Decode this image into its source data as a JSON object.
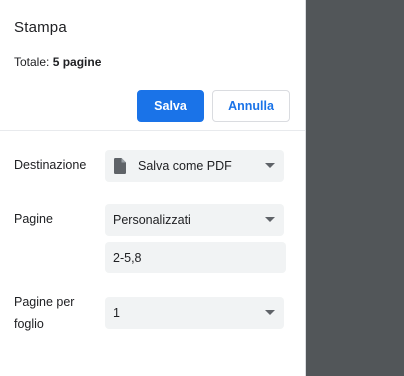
{
  "dialog": {
    "title": "Stampa",
    "summary_label": "Totale:",
    "summary_value": "5 pagine"
  },
  "actions": {
    "save_label": "Salva",
    "cancel_label": "Annulla"
  },
  "settings": {
    "destination": {
      "label": "Destinazione",
      "value": "Salva come PDF",
      "icon": "document-icon"
    },
    "pages": {
      "label": "Pagine",
      "value": "Personalizzati",
      "custom_range": "2-5,8"
    },
    "pages_per_sheet": {
      "label_line1": "Pagine per",
      "label_line2": "foglio",
      "value": "1"
    }
  },
  "colors": {
    "accent": "#1a73e8",
    "preview_bg": "#525659",
    "field_bg": "#f1f3f4"
  }
}
